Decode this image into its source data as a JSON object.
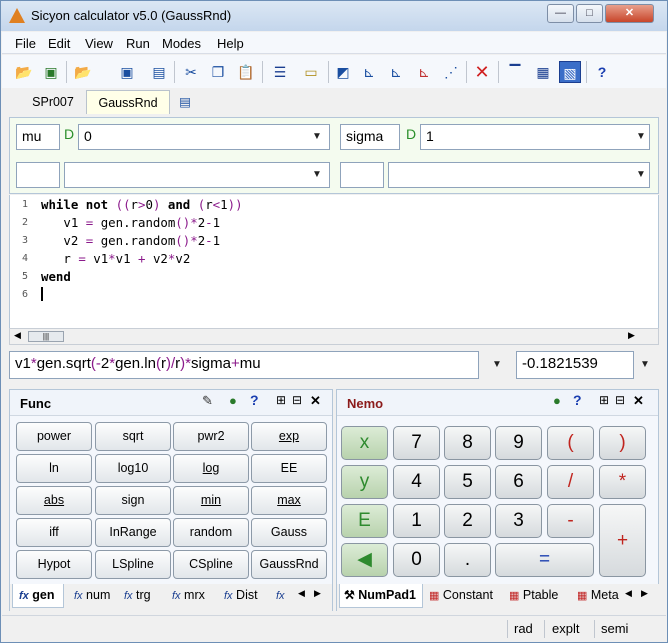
{
  "window": {
    "title": "Sicyon calculator v5.0 (GaussRnd)"
  },
  "menu": [
    "File",
    "Edit",
    "View",
    "Run",
    "Modes",
    "Help"
  ],
  "tabs": {
    "t1": "SPr007",
    "t2": "GaussRnd"
  },
  "params": {
    "p1_name": "mu",
    "p1_type": "D",
    "p1_value": "0",
    "p2_name": "sigma",
    "p2_type": "D",
    "p2_value": "1"
  },
  "code": {
    "lines": [
      "1",
      "2",
      "3",
      "4",
      "5",
      "6"
    ]
  },
  "expression": {
    "result": "-0.1821539"
  },
  "func_panel": {
    "title": "Func",
    "keys": [
      "power",
      "sqrt",
      "pwr2",
      "exp",
      "ln",
      "log10",
      "log",
      "EE",
      "abs",
      "sign",
      "min",
      "max",
      "iff",
      "InRange",
      "random",
      "Gauss",
      "Hypot",
      "LSpline",
      "CSpline",
      "GaussRnd"
    ],
    "tabs": [
      "gen",
      "num",
      "trg",
      "mrx",
      "Dist"
    ]
  },
  "nemo_panel": {
    "title": "Nemo",
    "keys": [
      "x",
      "7",
      "8",
      "9",
      "(",
      ")",
      "y",
      "4",
      "5",
      "6",
      "/",
      "*",
      "E",
      "1",
      "2",
      "3",
      "-",
      "+",
      "0",
      ".",
      "="
    ],
    "tabs": [
      "NumPad1",
      "Constant",
      "Ptable",
      "Meta"
    ]
  },
  "status": {
    "s1": "rad",
    "s2": "explt",
    "s3": "semi"
  },
  "colors": {
    "accent": "#2a8f2a",
    "operator": "#c0241e",
    "purple": "#8b1a8b"
  }
}
